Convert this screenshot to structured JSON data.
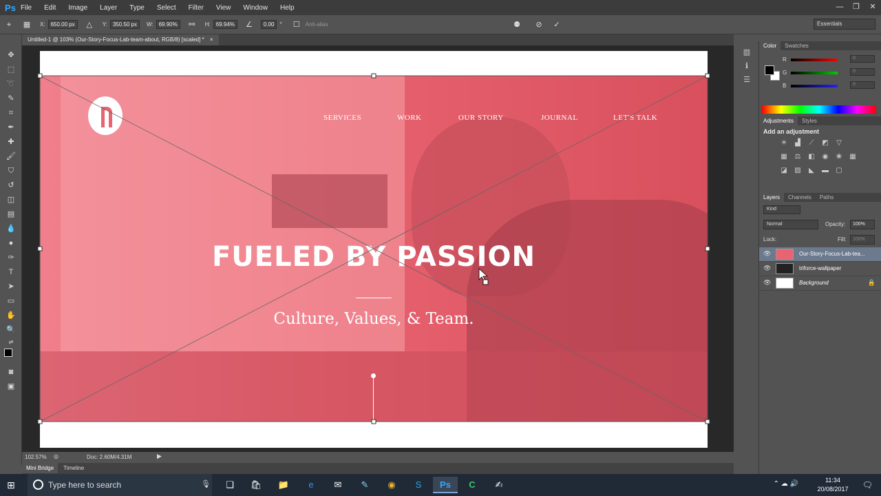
{
  "app": {
    "logo": "Ps"
  },
  "menu": [
    "File",
    "Edit",
    "Image",
    "Layer",
    "Type",
    "Select",
    "Filter",
    "View",
    "Window",
    "Help"
  ],
  "window_controls": [
    "—",
    "❐",
    "✕"
  ],
  "options": {
    "x_label": "X:",
    "x_value": "650.00 px",
    "y_label": "Y:",
    "y_value": "350.50 px",
    "w_label": "W:",
    "w_value": "69.90%",
    "h_label": "H:",
    "h_value": "69.94%",
    "angle_value": "0.00",
    "angle_unit": "°",
    "antialias_label": "Anti-alias",
    "workspace": "Essentials"
  },
  "document_tab": "Untitled-1 @ 103% (Our-Story-Focus-Lab-team-about, RGB/8) [scaled] *",
  "document_tab_close": "×",
  "hero": {
    "nav": [
      "SERVICES",
      "WORK",
      "OUR STORY",
      "JOURNAL",
      "LET'S TALK"
    ],
    "headline": "FUELED BY PASSION",
    "subline": "Culture, Values, & Team."
  },
  "status": {
    "zoom": "102.57%",
    "doc_size": "Doc: 2.60M/4.31M"
  },
  "bottom_tabs": [
    "Mini Bridge",
    "Timeline"
  ],
  "color_panel": {
    "tabs": [
      "Color",
      "Swatches"
    ],
    "channels": [
      {
        "label": "R",
        "value": "0",
        "color": "#d22222"
      },
      {
        "label": "G",
        "value": "0",
        "color": "#22aa22"
      },
      {
        "label": "B",
        "value": "0",
        "color": "#2244cc"
      }
    ]
  },
  "adjustments_panel": {
    "tabs": [
      "Adjustments",
      "Styles"
    ],
    "title": "Add an adjustment"
  },
  "layers_panel": {
    "tabs": [
      "Layers",
      "Channels",
      "Paths"
    ],
    "kind": "Kind",
    "blend_mode": "Normal",
    "opacity_label": "Opacity:",
    "opacity_value": "100%",
    "lock_label": "Lock:",
    "fill_label": "Fill:",
    "fill_value": "100%",
    "layers": [
      {
        "name": "Our-Story-Focus-Lab-tea...",
        "selected": true
      },
      {
        "name": "triforce-wallpaper",
        "selected": false
      },
      {
        "name": "Background",
        "selected": false
      }
    ]
  },
  "taskbar": {
    "search_placeholder": "Type here to search",
    "time": "11:34",
    "date": "20/08/2017"
  },
  "colors": {
    "hero_accent": "#e96370",
    "ps_blue": "#31a8ff",
    "selected_layer": "#6b7a8c"
  }
}
